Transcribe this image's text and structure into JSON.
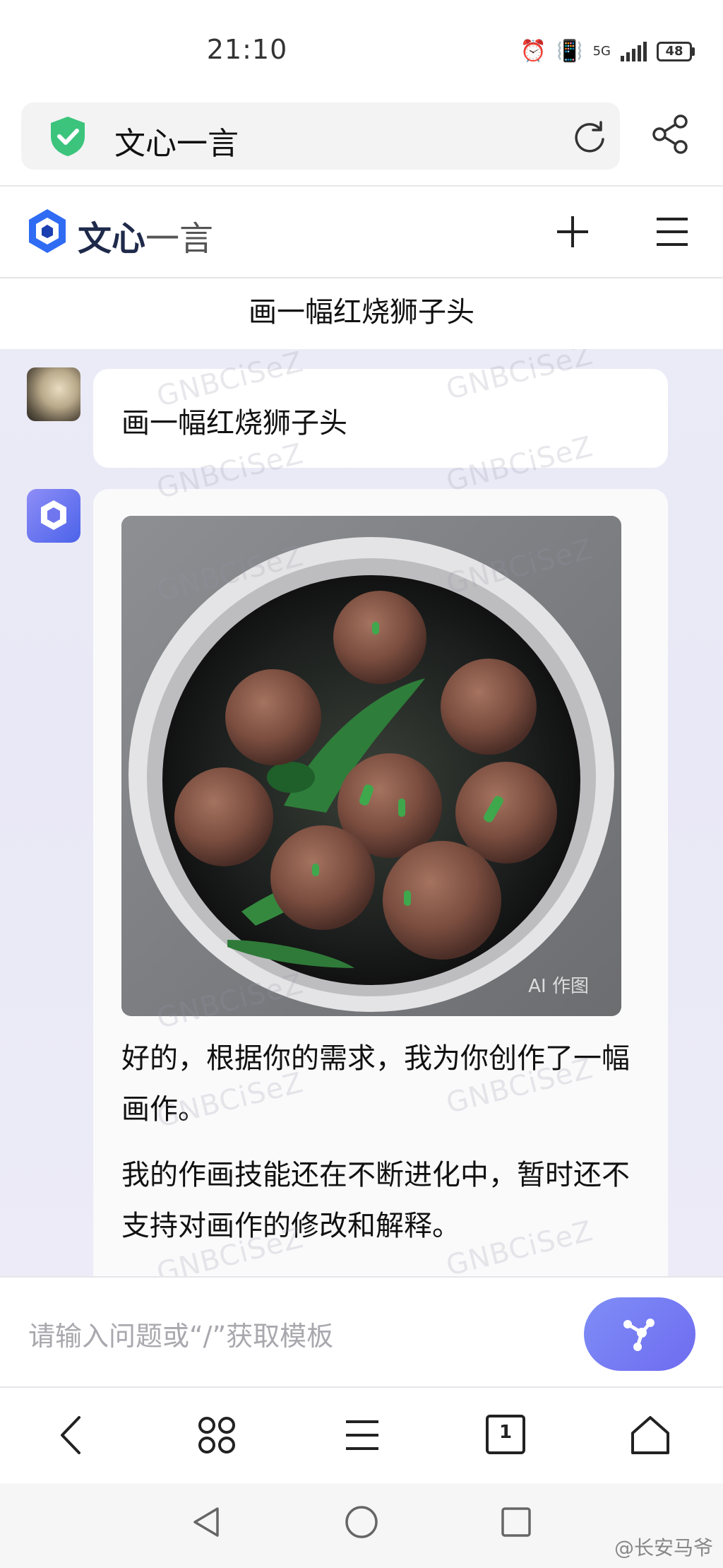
{
  "status_bar": {
    "time": "21:10",
    "network": "5G",
    "battery": "48"
  },
  "browser": {
    "url_title": "文心一言"
  },
  "app": {
    "logo_bold": "文心",
    "logo_light": "一言",
    "conversation_title": "画一幅红烧狮子头"
  },
  "chat": {
    "user_message": "画一幅红烧狮子头",
    "image_badge": "AI 作图",
    "reply_paragraph_1": "好的，根据你的需求，我为你创作了一幅画作。",
    "reply_paragraph_2": "我的作画技能还在不断进化中，暂时还不支持对画作的修改和解释。"
  },
  "watermark": "GNBCiSeZ",
  "input": {
    "placeholder": "请输入问题或“/”获取模板"
  },
  "browser_toolbar": {
    "tab_count": "1"
  },
  "corner_watermark": "@长安马爷",
  "icons": {
    "shield": "shield-check-icon",
    "reload": "reload-icon",
    "share": "share-icon",
    "new_chat": "plus-icon",
    "menu": "menu-icon",
    "send": "send-icon"
  },
  "colors": {
    "brand_blue": "#4b63ea",
    "shield_green": "#3cc47c",
    "send_gradient_start": "#7f8ef6",
    "chat_background": "#ebebf7"
  }
}
